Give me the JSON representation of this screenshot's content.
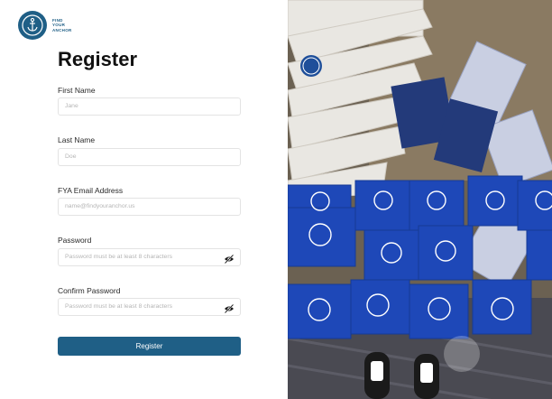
{
  "brand": {
    "line1": "FIND",
    "line2": "YOUR",
    "line3": "ANCHOR",
    "color": "#1f5f86"
  },
  "form": {
    "title": "Register",
    "first_name": {
      "label": "First Name",
      "placeholder": "Jane"
    },
    "last_name": {
      "label": "Last Name",
      "placeholder": "Doe"
    },
    "email": {
      "label": "FYA Email Address",
      "placeholder": "name@findyouranchor.us"
    },
    "password": {
      "label": "Password",
      "placeholder": "Password must be at least 8 characters"
    },
    "confirm_password": {
      "label": "Confirm Password",
      "placeholder": "Password must be at least 8 characters"
    },
    "submit_label": "Register"
  },
  "photo": {
    "caption": "Photo of stacks of blue Find Your Anchor boxes and 'You Are Not Alone' cards"
  }
}
